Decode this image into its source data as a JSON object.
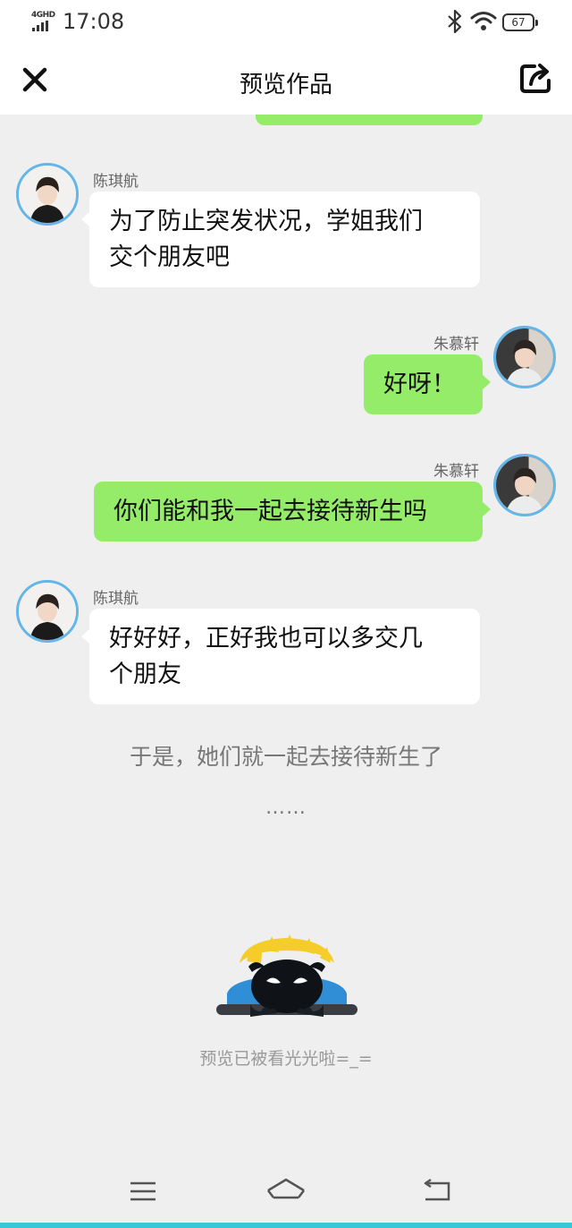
{
  "status_bar": {
    "network": "4GHD",
    "time": "17:08",
    "battery": "67",
    "icons": [
      "bluetooth-icon",
      "wifi-icon",
      "battery-icon"
    ]
  },
  "header": {
    "title": "预览作品",
    "close_icon": "close-icon",
    "share_icon": "share-icon"
  },
  "messages": [
    {
      "side": "left",
      "sender": "陈琪航",
      "text_lines": [
        "为了防止突发状况，学姐我们",
        "交个朋友吧"
      ]
    },
    {
      "side": "right",
      "sender": "朱慕轩",
      "text_lines": [
        "好呀！"
      ]
    },
    {
      "side": "right",
      "sender": "朱慕轩",
      "text_lines": [
        "你们能和我一起去接待新生吗"
      ]
    },
    {
      "side": "left",
      "sender": "陈琪航",
      "text_lines": [
        "好好好，正好我也可以多交几",
        "个朋友"
      ]
    }
  ],
  "narration": "于是，她们就一起去接待新生了",
  "ellipsis": "……",
  "end_text": "预览已被看光光啦=_=",
  "colors": {
    "bubble_right": "#95ec69",
    "bubble_left": "#ffffff",
    "avatar_ring": "#64b5e8",
    "background": "#efefef",
    "bottom_accent": "#35c9d6"
  },
  "nav_bar": {
    "icons": [
      "menu-icon",
      "home-icon",
      "back-icon"
    ]
  }
}
